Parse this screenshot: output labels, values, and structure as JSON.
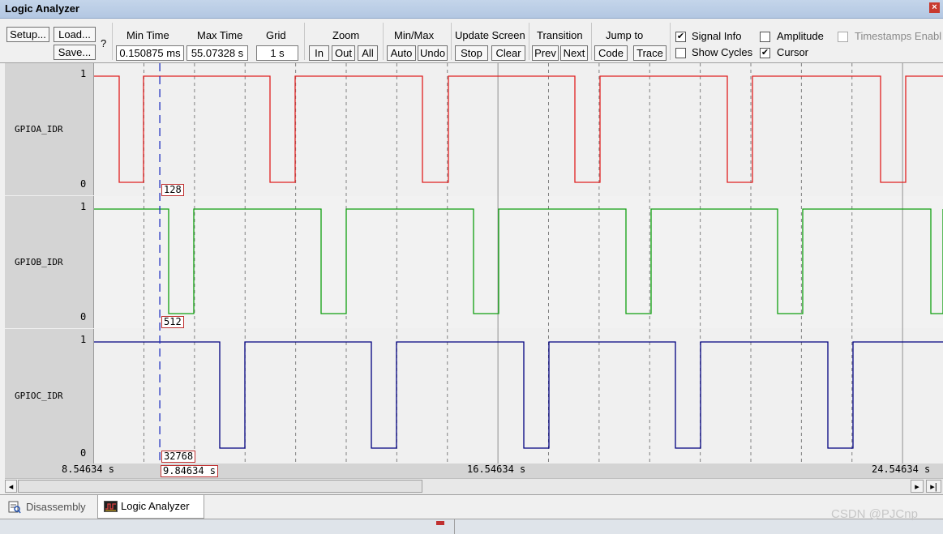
{
  "window": {
    "title": "Logic Analyzer",
    "close_glyph": "×"
  },
  "toolbar": {
    "setup": "Setup...",
    "load": "Load...",
    "save": "Save...",
    "help": "?",
    "min_time": {
      "label": "Min Time",
      "value": "0.150875 ms"
    },
    "max_time": {
      "label": "Max Time",
      "value": "55.07328 s"
    },
    "grid": {
      "label": "Grid",
      "value": "1 s"
    },
    "zoom": {
      "label": "Zoom",
      "in": "In",
      "out": "Out",
      "all": "All"
    },
    "minmax": {
      "label": "Min/Max",
      "auto": "Auto",
      "undo": "Undo"
    },
    "update_screen": {
      "label": "Update Screen",
      "stop": "Stop",
      "clear": "Clear"
    },
    "transition": {
      "label": "Transition",
      "prev": "Prev",
      "next": "Next"
    },
    "jump_to": {
      "label": "Jump to",
      "code": "Code",
      "trace": "Trace"
    },
    "options": {
      "signal_info": {
        "label": "Signal Info",
        "checked": true
      },
      "show_cycles": {
        "label": "Show Cycles",
        "checked": false
      },
      "amplitude": {
        "label": "Amplitude",
        "checked": false
      },
      "cursor": {
        "label": "Cursor",
        "checked": true
      },
      "timestamps": {
        "label": "Timestamps Enabl",
        "checked": false,
        "disabled": true
      }
    }
  },
  "signals": [
    {
      "name": "GPIOA_IDR",
      "high_label": "1",
      "low_label": "0",
      "color": "#e02020",
      "cursor_value": "128"
    },
    {
      "name": "GPIOB_IDR",
      "high_label": "1",
      "low_label": "0",
      "color": "#10a010",
      "cursor_value": "512"
    },
    {
      "name": "GPIOC_IDR",
      "high_label": "1",
      "low_label": "0",
      "color": "#000080",
      "cursor_value": "32768"
    }
  ],
  "timeline": {
    "start_label": "8.54634 s",
    "mid_label": "16.54634 s",
    "end_label": "24.54634 s",
    "cursor_label": "9.84634 s",
    "start_s": 8.54634,
    "end_s": 24.54634,
    "cursor_s": 9.84634
  },
  "scrollbar": {
    "left_arrow": "◂",
    "right_arrow": "▸",
    "end_glyph": "▸|"
  },
  "tabs": {
    "disassembly": "Disassembly",
    "logic_analyzer": "Logic Analyzer",
    "active": "logic_analyzer"
  },
  "watermark": "CSDN @PJCnp",
  "colors": {
    "cursor_line": "#2030c0",
    "grid_line": "#808080",
    "panel_shade": "#f2f2f2"
  }
}
